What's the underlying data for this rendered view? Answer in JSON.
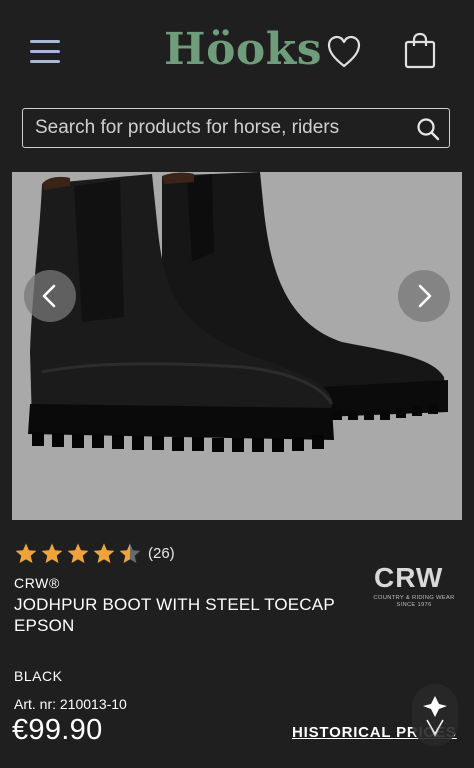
{
  "header": {
    "logo_text": "Höoks",
    "menu_icon": "hamburger-menu-icon",
    "wishlist_icon": "heart-icon",
    "cart_icon": "shopping-bag-icon"
  },
  "search": {
    "placeholder": "Search for products for horse, riders",
    "value": "",
    "icon": "search-icon"
  },
  "gallery": {
    "prev_icon": "chevron-left-icon",
    "next_icon": "chevron-right-icon",
    "image": "black jodhpur boots pair"
  },
  "product": {
    "rating": 4.5,
    "stars_max": 5,
    "review_count": "(26)",
    "brand": "CRW®",
    "title": "JODHPUR BOOT WITH STEEL TOECAP EPSON",
    "brand_logo": {
      "text": "CRW",
      "subtitle_line1": "COUNTRY & RIDING WEAR",
      "subtitle_line2": "SINCE 1976"
    },
    "color": "BLACK",
    "article_number": "Art. nr: 210013-10",
    "price": "€99.90",
    "historical_prices_link": "HISTORICAL PRICES"
  },
  "colors": {
    "background": "#1f1f1f",
    "logo_green": "#6f9c7a",
    "menu_blue": "#a9b7d8",
    "star_orange": "#f0a23b"
  },
  "chat": {
    "icon": "chat-assistant-icon"
  }
}
